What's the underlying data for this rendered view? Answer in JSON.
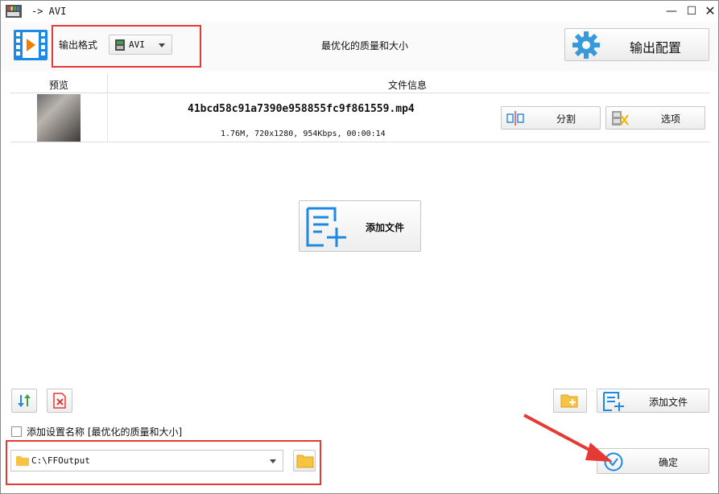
{
  "window": {
    "title": "-> AVI",
    "controls": {
      "minimize": "—",
      "maximize": "☐",
      "close": "✕"
    }
  },
  "toolbar": {
    "format_label": "输出格式",
    "format_value": "AVI",
    "quality_text": "最优化的质量和大小",
    "config_button": "输出配置"
  },
  "file_list": {
    "columns": [
      "预览",
      "文件信息"
    ],
    "items": [
      {
        "filename": "41bcd58c91a7390e958855fc9f861559.mp4",
        "meta": "1.76M, 720x1280, 954Kbps, 00:00:14",
        "split_label": "分割",
        "options_label": "选项"
      }
    ]
  },
  "center": {
    "add_file_label": "添加文件"
  },
  "bottom": {
    "add_file_label": "添加文件",
    "checkbox_label": "添加设置名称 [最优化的质量和大小]",
    "checkbox_checked": false,
    "output_path": "C:\\FFOutput",
    "ok_label": "确定"
  },
  "colors": {
    "accent_blue": "#1e88e5",
    "highlight_red": "#e53935",
    "folder_yellow": "#f6c342"
  }
}
